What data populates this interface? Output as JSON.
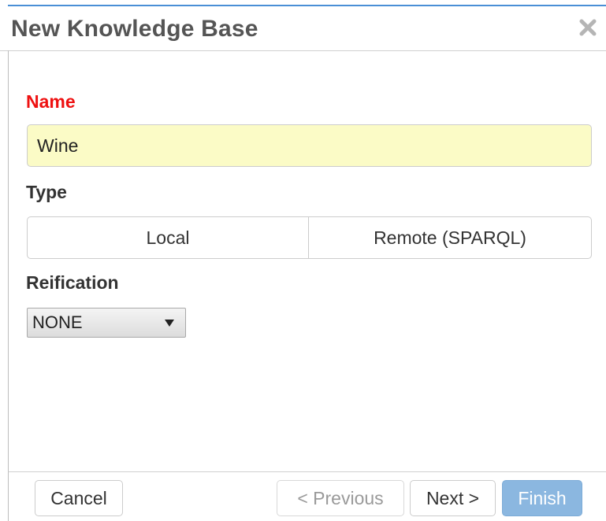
{
  "dialog": {
    "title": "New Knowledge Base"
  },
  "form": {
    "name_label": "Name",
    "name_value": "Wine",
    "type_label": "Type",
    "type_options": [
      "Local",
      "Remote (SPARQL)"
    ],
    "reification_label": "Reification",
    "reification_selected": "NONE"
  },
  "footer": {
    "cancel_label": "Cancel",
    "previous_label": "< Previous",
    "next_label": "Next >",
    "finish_label": "Finish"
  },
  "colors": {
    "required_label": "#ee1111",
    "input_highlight": "#fbfbc6",
    "accent": "#4a8fd6",
    "finish_button": "#7fb0dd"
  },
  "icons": {
    "close": "close-icon"
  }
}
